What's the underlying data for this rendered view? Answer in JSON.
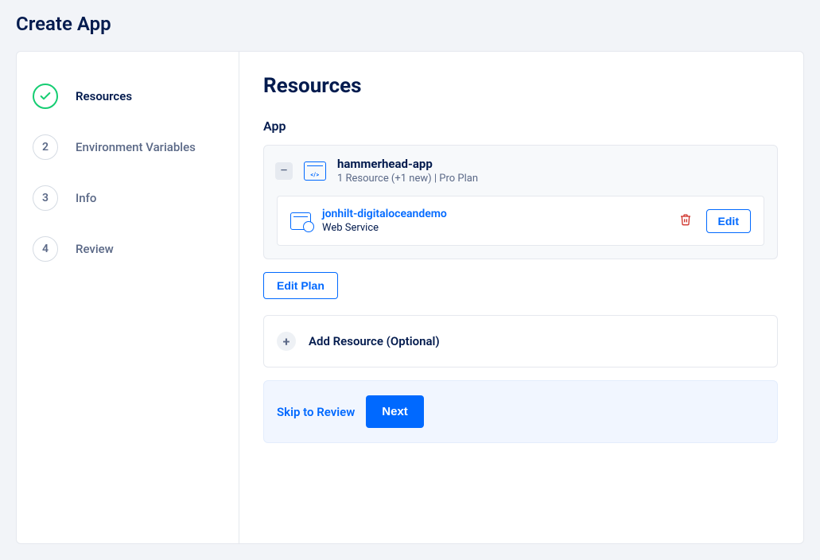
{
  "page_title": "Create App",
  "steps": [
    {
      "label": "Resources",
      "state": "done"
    },
    {
      "label": "Environment Variables",
      "state": "pending",
      "num": "2"
    },
    {
      "label": "Info",
      "state": "pending",
      "num": "3"
    },
    {
      "label": "Review",
      "state": "pending",
      "num": "4"
    }
  ],
  "main": {
    "heading": "Resources",
    "app_section_label": "App",
    "app": {
      "name": "hammerhead-app",
      "meta": "1 Resource (+1 new) | Pro Plan",
      "resource": {
        "name": "jonhilt-digitaloceandemo",
        "type": "Web Service",
        "edit_label": "Edit"
      }
    },
    "edit_plan_label": "Edit Plan",
    "add_resource_label": "Add Resource (Optional)",
    "skip_label": "Skip to Review",
    "next_label": "Next"
  }
}
